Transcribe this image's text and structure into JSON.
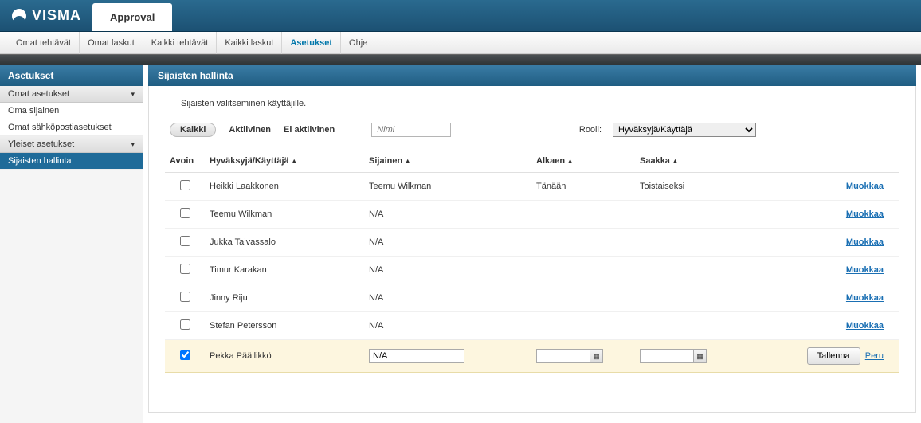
{
  "brand": "VISMA",
  "top_tab": "Approval",
  "menu": {
    "items": [
      "Omat tehtävät",
      "Omat laskut",
      "Kaikki tehtävät",
      "Kaikki laskut",
      "Asetukset",
      "Ohje"
    ],
    "active_index": 4
  },
  "sidebar": {
    "title": "Asetukset",
    "groups": [
      {
        "label": "Omat asetukset",
        "items": [
          "Oma sijainen",
          "Omat sähköpostiasetukset"
        ]
      },
      {
        "label": "Yleiset asetukset",
        "items": [
          "Sijaisten hallinta"
        ],
        "active_item": 0
      }
    ]
  },
  "content": {
    "title": "Sijaisten hallinta",
    "description": "Sijaisten valitseminen käyttäjille.",
    "filters": {
      "all": "Kaikki",
      "active": "Aktiivinen",
      "inactive": "Ei aktiivinen",
      "name_placeholder": "Nimi",
      "role_label": "Rooli:",
      "role_value": "Hyväksyjä/Käyttäjä"
    },
    "columns": {
      "open": "Avoin",
      "user": "Hyväksyjä/Käyttäjä",
      "substitute": "Sijainen",
      "from": "Alkaen",
      "until": "Saakka"
    },
    "edit_label": "Muokkaa",
    "save_label": "Tallenna",
    "cancel_label": "Peru",
    "rows": [
      {
        "open": false,
        "user": "Heikki Laakkonen",
        "substitute": "Teemu Wilkman",
        "from": "Tänään",
        "until": "Toistaiseksi"
      },
      {
        "open": false,
        "user": "Teemu Wilkman",
        "substitute": "N/A",
        "from": "",
        "until": ""
      },
      {
        "open": false,
        "user": "Jukka Taivassalo",
        "substitute": "N/A",
        "from": "",
        "until": ""
      },
      {
        "open": false,
        "user": "Timur Karakan",
        "substitute": "N/A",
        "from": "",
        "until": ""
      },
      {
        "open": false,
        "user": "Jinny Riju",
        "substitute": "N/A",
        "from": "",
        "until": ""
      },
      {
        "open": false,
        "user": "Stefan Petersson",
        "substitute": "N/A",
        "from": "",
        "until": ""
      }
    ],
    "editing_row": {
      "open": true,
      "user": "Pekka Päällikkö",
      "substitute": "N/A",
      "from": "",
      "until": ""
    }
  }
}
